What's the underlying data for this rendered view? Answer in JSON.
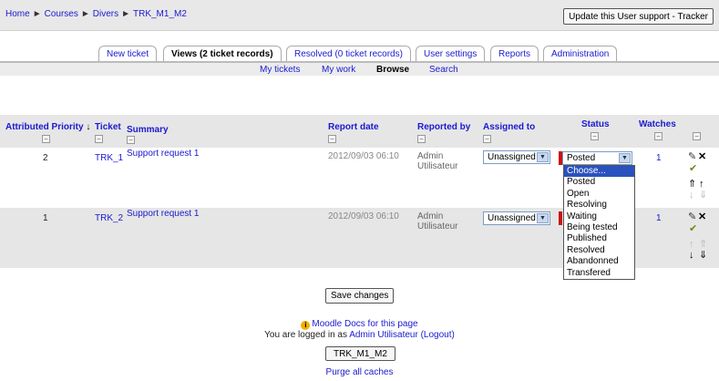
{
  "breadcrumb": [
    {
      "label": "Home"
    },
    {
      "label": "Courses"
    },
    {
      "label": "Divers"
    },
    {
      "label": "TRK_M1_M2"
    }
  ],
  "breadcrumb_separator": "►",
  "header": {
    "update_button": "Update this User support - Tracker"
  },
  "tabs": [
    {
      "label": "New ticket"
    },
    {
      "label": "Views (2 ticket records)"
    },
    {
      "label": "Resolved (0 ticket records)"
    },
    {
      "label": "User settings"
    },
    {
      "label": "Reports"
    },
    {
      "label": "Administration"
    }
  ],
  "subtabs": [
    {
      "label": "My tickets"
    },
    {
      "label": "My work"
    },
    {
      "label": "Browse"
    },
    {
      "label": "Search"
    }
  ],
  "columns": {
    "priority": "Attributed Priority",
    "priority_sort_icon": "↓",
    "ticket": "Ticket",
    "summary": "Summary",
    "report_date": "Report date",
    "reported_by": "Reported by",
    "assigned_to": "Assigned to",
    "status": "Status",
    "watches": "Watches",
    "collapse_glyph": "−"
  },
  "rows": [
    {
      "priority": "2",
      "ticket": "TRK_1",
      "summary": "Support request 1",
      "report_date": "2012/09/03 06:10",
      "reported_by_first": "Admin",
      "reported_by_last": "Utilisateur",
      "assigned_to": "Unassigned",
      "status": "Posted",
      "watches": "1"
    },
    {
      "priority": "1",
      "ticket": "TRK_2",
      "summary": "Support request 1",
      "report_date": "2012/09/03 06:10",
      "reported_by_first": "Admin",
      "reported_by_last": "Utilisateur",
      "assigned_to": "Unassigned",
      "status": "",
      "watches": "1"
    }
  ],
  "status_options": [
    "Choose...",
    "Posted",
    "Open",
    "Resolving",
    "Waiting",
    "Being tested",
    "Published",
    "Resolved",
    "Abandonned",
    "Transfered"
  ],
  "status_highlighted": "Choose...",
  "icons": {
    "select_arrow": "▼",
    "edit": "✎",
    "delete": "✕",
    "checkmark": "✔",
    "up": "↑",
    "down": "↓",
    "top": "⇑",
    "bottom": "⇓",
    "info": "i"
  },
  "colors": {
    "link": "#1a1ad0",
    "status_marker": "#cc1010",
    "highlight": "#2a52be"
  },
  "save_button": "Save changes",
  "footer": {
    "docs_link": "Moodle Docs for this page",
    "logged_in_prefix": "You are logged in as",
    "user_name": "Admin Utilisateur",
    "logout": "(Logout)",
    "course_button": "TRK_M1_M2",
    "purge": "Purge all caches"
  }
}
